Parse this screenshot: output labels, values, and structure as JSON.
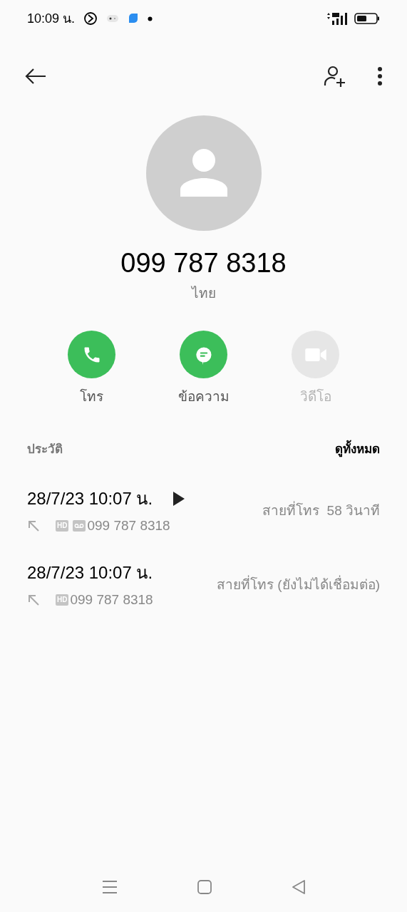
{
  "status_bar": {
    "time": "10:09 น."
  },
  "contact": {
    "number": "099 787 8318",
    "location": "ไทย"
  },
  "actions": [
    {
      "kind": "call",
      "label": "โทร",
      "disabled": false
    },
    {
      "kind": "message",
      "label": "ข้อความ",
      "disabled": false
    },
    {
      "kind": "video",
      "label": "วิดีโอ",
      "disabled": true
    }
  ],
  "history": {
    "title": "ประวัติ",
    "see_all": "ดูทั้งหมด",
    "calls": [
      {
        "datetime": "28/7/23 10:07 น.",
        "recording": true,
        "hd_badge": "HD",
        "voicemail": true,
        "number": "099 787 8318",
        "status": "สายที่โทร  58 วินาที"
      },
      {
        "datetime": "28/7/23 10:07 น.",
        "recording": false,
        "hd_badge": "HD",
        "voicemail": false,
        "number": "099 787 8318",
        "status": "สายที่โทร (ยังไม่ได้เชื่อมต่อ)"
      }
    ]
  }
}
